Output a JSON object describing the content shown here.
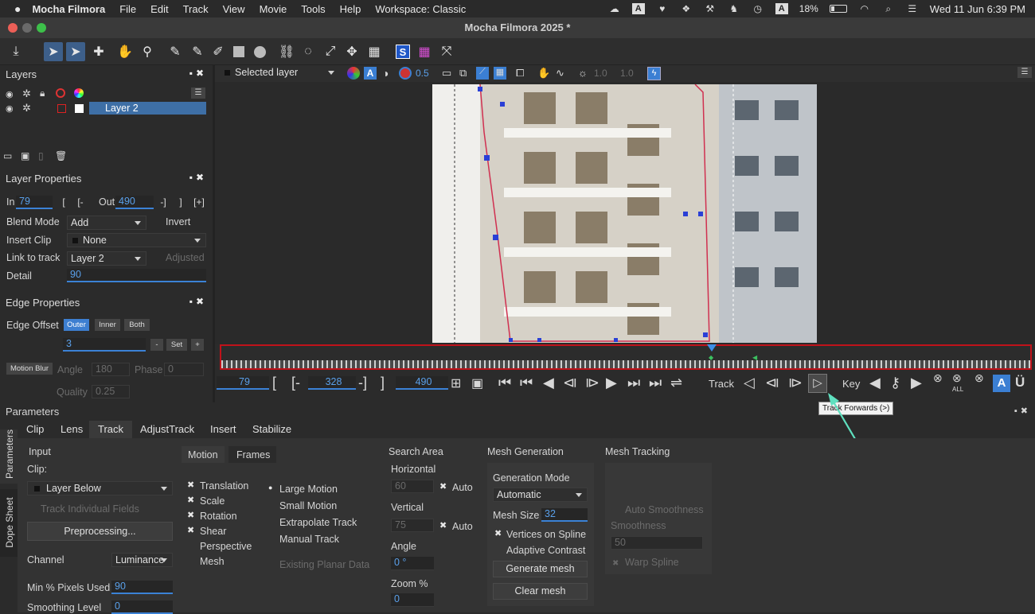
{
  "menubar": {
    "apple": "",
    "app": "Mocha Filmora",
    "items": [
      "File",
      "Edit",
      "Track",
      "View",
      "Movie",
      "Tools",
      "Help",
      "Workspace: Classic"
    ],
    "battery": "18%",
    "datetime": "Wed 11 Jun  6:39 PM"
  },
  "window": {
    "title": "Mocha Filmora 2025 *"
  },
  "layers": {
    "title": "Layers",
    "layer_name": "Layer 2"
  },
  "viewer_toolbar": {
    "layer_select": "Selected layer",
    "opacity": "0.5",
    "val1": "1.0",
    "val2": "1.0"
  },
  "layer_properties": {
    "title": "Layer Properties",
    "in_label": "In",
    "in_value": "79",
    "out_label": "Out",
    "out_value": "490",
    "blend_mode_label": "Blend Mode",
    "blend_mode": "Add",
    "invert_label": "Invert",
    "insert_clip_label": "Insert Clip",
    "insert_clip": "None",
    "link_to_track_label": "Link to track",
    "link_to_track": "Layer 2",
    "adjusted_label": "Adjusted",
    "detail_label": "Detail",
    "detail_value": "90"
  },
  "edge_properties": {
    "title": "Edge Properties",
    "edge_offset_label": "Edge Offset",
    "outer": "Outer",
    "inner": "Inner",
    "both": "Both",
    "offset_value": "3",
    "minus": "-",
    "set": "Set",
    "plus": "+",
    "motion_blur": "Motion Blur",
    "angle_label": "Angle",
    "angle_value": "180",
    "phase_label": "Phase",
    "phase_value": "0",
    "quality_label": "Quality",
    "quality_value": "0.25"
  },
  "transport": {
    "current": "79",
    "in_point": "328",
    "out_point": "490",
    "track_label": "Track",
    "key_label": "Key",
    "tooltip": "Track Forwards (>)",
    "all_label": "ALL"
  },
  "parameters": {
    "title": "Parameters",
    "tabs": [
      "Clip",
      "Lens",
      "Track",
      "AdjustTrack",
      "Insert",
      "Stabilize"
    ],
    "side_tabs": [
      "Parameters",
      "Dope Sheet"
    ],
    "input": {
      "title": "Input",
      "clip_label": "Clip:",
      "clip_value": "Layer Below",
      "track_individual": "Track Individual Fields",
      "preprocessing": "Preprocessing...",
      "channel_label": "Channel",
      "channel_value": "Luminance",
      "min_pixels_label": "Min % Pixels Used",
      "min_pixels_value": "90",
      "smoothing_label": "Smoothing Level",
      "smoothing_value": "0"
    },
    "motion": {
      "tab_motion": "Motion",
      "tab_frames": "Frames",
      "translation": "Translation",
      "scale": "Scale",
      "rotation": "Rotation",
      "shear": "Shear",
      "perspective": "Perspective",
      "mesh": "Mesh",
      "large_motion": "Large Motion",
      "small_motion": "Small Motion",
      "extrapolate_track": "Extrapolate Track",
      "manual_track": "Manual Track",
      "existing_planar": "Existing Planar Data"
    },
    "search_area": {
      "title": "Search Area",
      "horizontal_label": "Horizontal",
      "horizontal_value": "60",
      "auto": "Auto",
      "vertical_label": "Vertical",
      "vertical_value": "75",
      "angle_label": "Angle",
      "angle_value": "0 °",
      "zoom_label": "Zoom %",
      "zoom_value": "0"
    },
    "mesh_generation": {
      "title": "Mesh Generation",
      "mode_label": "Generation Mode",
      "mode_value": "Automatic",
      "mesh_size_label": "Mesh Size",
      "mesh_size_value": "32",
      "vertices_on_spline": "Vertices on Spline",
      "adaptive_contrast": "Adaptive Contrast",
      "generate_mesh": "Generate mesh",
      "clear_mesh": "Clear mesh"
    },
    "mesh_tracking": {
      "title": "Mesh Tracking",
      "auto_smoothness": "Auto Smoothness",
      "smoothness_label": "Smoothness",
      "smoothness_value": "50",
      "warp_spline": "Warp Spline"
    }
  }
}
